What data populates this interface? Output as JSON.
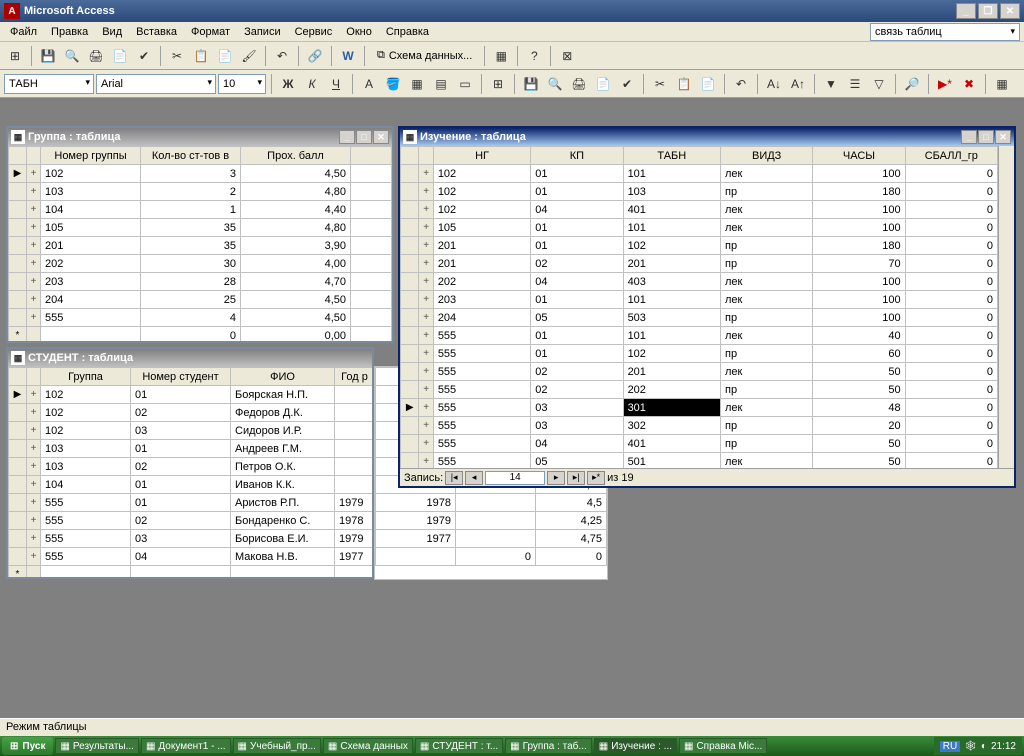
{
  "app": {
    "title": "Microsoft Access"
  },
  "menubar": [
    "Файл",
    "Правка",
    "Вид",
    "Вставка",
    "Формат",
    "Записи",
    "Сервис",
    "Окно",
    "Справка"
  ],
  "helpbox": "связь таблиц",
  "toolbar1": {
    "schema_btn": "Схема данных..."
  },
  "format_bar": {
    "object": "ТАБН",
    "font": "Arial",
    "size": "10"
  },
  "statusbar": "Режим таблицы",
  "windows": {
    "group": {
      "title": "Группа : таблица",
      "cols": [
        "Номер группы",
        "Кол-во ст-тов в",
        "Прох. балл"
      ],
      "rows": [
        [
          "102",
          "3",
          "4,50"
        ],
        [
          "103",
          "2",
          "4,80"
        ],
        [
          "104",
          "1",
          "4,40"
        ],
        [
          "105",
          "35",
          "4,80"
        ],
        [
          "201",
          "35",
          "3,90"
        ],
        [
          "202",
          "30",
          "4,00"
        ],
        [
          "203",
          "28",
          "4,70"
        ],
        [
          "204",
          "25",
          "4,50"
        ],
        [
          "555",
          "4",
          "4,50"
        ]
      ],
      "newrow": [
        "",
        "0",
        "0,00"
      ]
    },
    "student": {
      "title": "СТУДЕНТ : таблица",
      "cols": [
        "Группа",
        "Номер студент",
        "ФИО",
        "Год р"
      ],
      "rows": [
        [
          "102",
          "01",
          "Боярская Н.П.",
          ""
        ],
        [
          "102",
          "02",
          "Федоров Д.К.",
          ""
        ],
        [
          "102",
          "03",
          "Сидоров И.Р.",
          ""
        ],
        [
          "103",
          "01",
          "Андреев Г.М.",
          ""
        ],
        [
          "103",
          "02",
          "Петров О.К.",
          ""
        ],
        [
          "104",
          "01",
          "Иванов К.К.",
          ""
        ],
        [
          "555",
          "01",
          "Аристов Р.П.",
          "1979"
        ],
        [
          "555",
          "02",
          "Бондаренко С.",
          "1978"
        ],
        [
          "555",
          "03",
          "Борисова Е.И.",
          "1979"
        ],
        [
          "555",
          "04",
          "Макова Н.В.",
          "1977"
        ]
      ],
      "ext_years": [
        "",
        "",
        "",
        "",
        "",
        "",
        "1979",
        "1978",
        "1979",
        "1977",
        ""
      ],
      "ext_vals": [
        "",
        "",
        "",
        "",
        "",
        "",
        "4,25",
        "4,5",
        "4,25",
        "4,75",
        "0"
      ],
      "ext_zero_col": "0",
      "newrow": [
        "",
        "",
        "",
        ""
      ]
    },
    "study": {
      "title": "Изучение : таблица",
      "cols": [
        "НГ",
        "КП",
        "ТАБН",
        "ВИДЗ",
        "ЧАСЫ",
        "СБАЛЛ_гр"
      ],
      "rows": [
        [
          "102",
          "01",
          "101",
          "лек",
          "100",
          "0"
        ],
        [
          "102",
          "01",
          "103",
          "пр",
          "180",
          "0"
        ],
        [
          "102",
          "04",
          "401",
          "лек",
          "100",
          "0"
        ],
        [
          "105",
          "01",
          "101",
          "лек",
          "100",
          "0"
        ],
        [
          "201",
          "01",
          "102",
          "пр",
          "180",
          "0"
        ],
        [
          "201",
          "02",
          "201",
          "пр",
          "70",
          "0"
        ],
        [
          "202",
          "04",
          "403",
          "лек",
          "100",
          "0"
        ],
        [
          "203",
          "01",
          "101",
          "лек",
          "100",
          "0"
        ],
        [
          "204",
          "05",
          "503",
          "пр",
          "100",
          "0"
        ],
        [
          "555",
          "01",
          "101",
          "лек",
          "40",
          "0"
        ],
        [
          "555",
          "01",
          "102",
          "пр",
          "60",
          "0"
        ],
        [
          "555",
          "02",
          "201",
          "лек",
          "50",
          "0"
        ],
        [
          "555",
          "02",
          "202",
          "пр",
          "50",
          "0"
        ],
        [
          "555",
          "03",
          "301",
          "лек",
          "48",
          "0"
        ],
        [
          "555",
          "03",
          "302",
          "пр",
          "20",
          "0"
        ],
        [
          "555",
          "04",
          "401",
          "пр",
          "50",
          "0"
        ],
        [
          "555",
          "05",
          "501",
          "лек",
          "50",
          "0"
        ]
      ],
      "sel_row": 13,
      "sel_col": 2,
      "nav": {
        "label": "Запись:",
        "pos": "14",
        "total": "из  19"
      }
    }
  },
  "taskbar": {
    "start": "Пуск",
    "items": [
      "Результаты...",
      "Документ1 - ...",
      "Учебный_пр...",
      "Схема данных",
      "СТУДЕНТ : т...",
      "Группа : таб...",
      "Изучение : ...",
      "Справка Mic..."
    ],
    "active_idx": 6,
    "lang": "RU",
    "time": "21:12"
  }
}
